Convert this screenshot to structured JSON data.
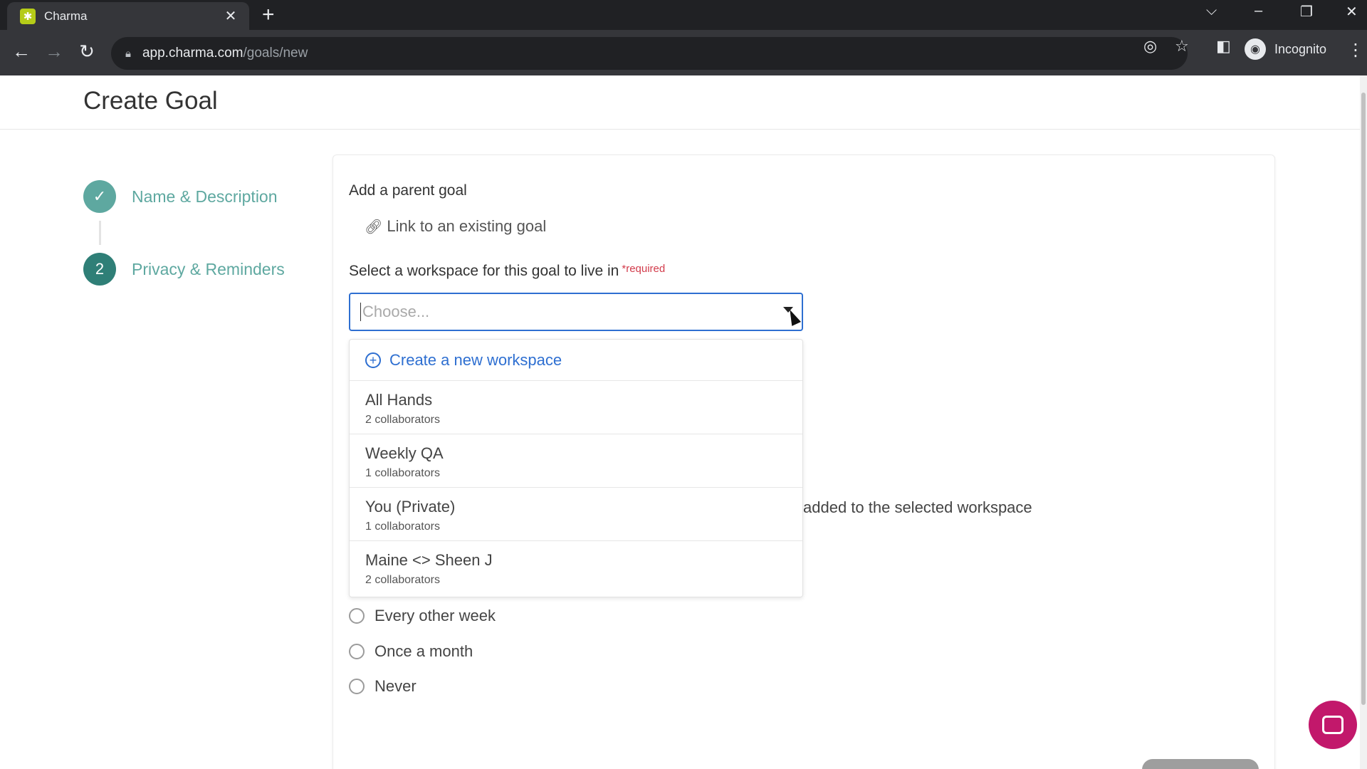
{
  "browser": {
    "tab_title": "Charma",
    "tab_close": "✕",
    "new_tab": "+",
    "url_host": "app.charma.com",
    "url_path": "/goals/new",
    "profile_label": "Incognito"
  },
  "page": {
    "title": "Create Goal"
  },
  "steps": [
    {
      "label": "Name & Description",
      "marker": "✓",
      "color": "#5ea8a0"
    },
    {
      "label": "Privacy & Reminders",
      "marker": "2",
      "color": "#2f7f77"
    }
  ],
  "form": {
    "parent_goal_label": "Add a parent goal",
    "link_existing_label": "Link to an existing goal",
    "workspace_label": "Select a workspace for this goal to live in",
    "required_label": "*required",
    "workspace_placeholder": "Choose...",
    "partial_hint": "added to the selected workspace"
  },
  "dropdown": {
    "create_label": "Create a new workspace",
    "options": [
      {
        "name": "All Hands",
        "sub": "2 collaborators"
      },
      {
        "name": "Weekly QA",
        "sub": "1 collaborators"
      },
      {
        "name": "You (Private)",
        "sub": "1 collaborators"
      },
      {
        "name": "Maine <> Sheen J",
        "sub": "2 collaborators"
      }
    ]
  },
  "reminders": {
    "options": [
      {
        "label": "Every other week",
        "selected": false
      },
      {
        "label": "Once a month",
        "selected": false
      },
      {
        "label": "Never",
        "selected": false
      }
    ]
  },
  "colors": {
    "accent_blue": "#2e6fd1",
    "step_teal": "#5ea8a0",
    "required_red": "#d23b4b",
    "chat_magenta": "#c2186b"
  }
}
